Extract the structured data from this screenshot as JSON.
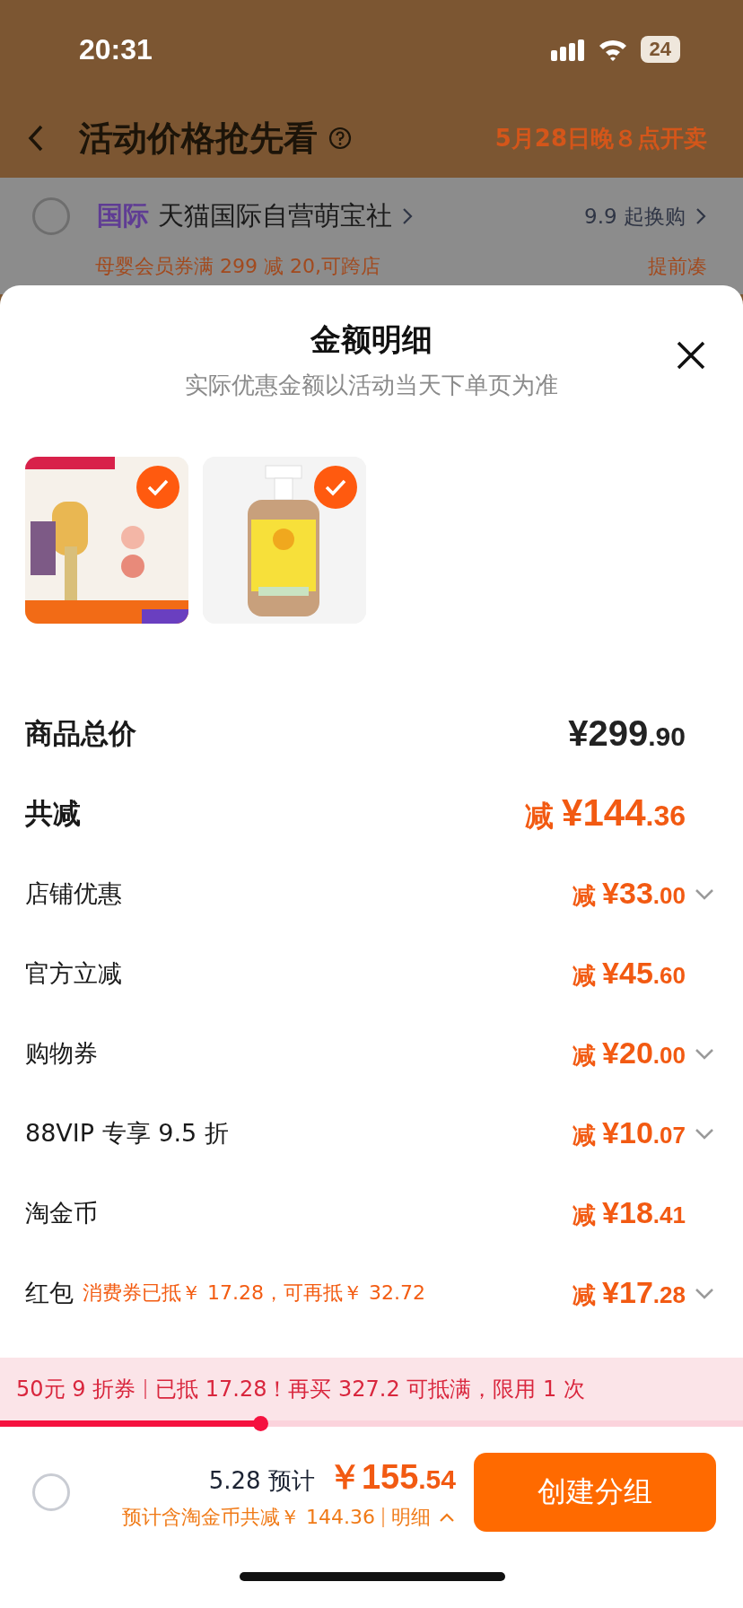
{
  "status_bar": {
    "time": "20:31",
    "battery": "24"
  },
  "header": {
    "title": "活动价格抢先看",
    "sale_time": "5月28日晚８点开卖"
  },
  "store": {
    "selected": false,
    "badge": "国际",
    "name": "天猫国际自营萌宝社",
    "swap": "9.9 起换购",
    "promo": "母婴会员券满 299 减 20,可跨店",
    "promo_action": "提前凑"
  },
  "sheet": {
    "title": "金额明细",
    "subtitle": "实际优惠金额以活动当天下单页为准",
    "products": [
      {
        "kind": "picture",
        "selected": true
      },
      {
        "kind": "picture",
        "selected": true
      }
    ],
    "rows": [
      {
        "kind": "total",
        "label": "商品总价",
        "prefix": "",
        "amount": "¥299",
        "cents": ".90",
        "expandable": false
      },
      {
        "kind": "discount_total",
        "label": "共减",
        "prefix": "减",
        "amount": "¥144",
        "cents": ".36",
        "expandable": false
      },
      {
        "kind": "item",
        "label": "店铺优惠",
        "prefix": "减",
        "amount": "¥33",
        "cents": ".00",
        "expandable": true
      },
      {
        "kind": "item",
        "label": "官方立减",
        "prefix": "减",
        "amount": "¥45",
        "cents": ".60",
        "expandable": false
      },
      {
        "kind": "item",
        "label": "购物券",
        "prefix": "减",
        "amount": "¥20",
        "cents": ".00",
        "expandable": true
      },
      {
        "kind": "item",
        "label": "88VIP 专享 9.5 折",
        "prefix": "减",
        "amount": "¥10",
        "cents": ".07",
        "expandable": true
      },
      {
        "kind": "item",
        "label": "淘金币",
        "prefix": "减",
        "amount": "¥18",
        "cents": ".41",
        "expandable": false
      },
      {
        "kind": "item",
        "label": "红包",
        "note": "消费券已抵￥ 17.28，可再抵￥ 32.72",
        "prefix": "减",
        "amount": "¥17",
        "cents": ".28",
        "expandable": true
      }
    ]
  },
  "coupon_bar": {
    "name": "50元 9 折券",
    "message": "已抵 17.28！再买 327.2 可抵满，限用 1 次",
    "level": 0.35
  },
  "footer": {
    "selected": false,
    "date_label": "5.28 预计",
    "amount": "￥155",
    "cents": ".54",
    "summary": "预计含淘金币共减￥ 144.36",
    "detail": "明细",
    "button": "创建分组"
  }
}
